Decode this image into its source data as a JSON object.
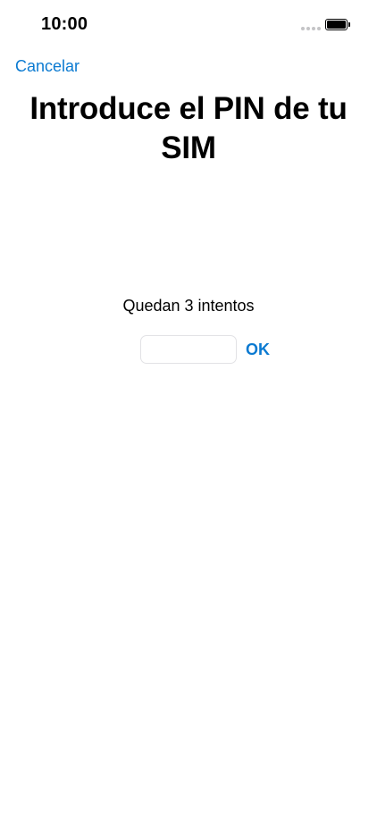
{
  "status_bar": {
    "time": "10:00",
    "signal_icon": "signal-dots-icon",
    "battery_icon": "battery-full-icon"
  },
  "nav": {
    "cancel_label": "Cancelar"
  },
  "main": {
    "title": "Introduce el PIN de tu SIM",
    "attempts_text": "Quedan 3 intentos",
    "pin_input_value": "",
    "ok_label": "OK"
  },
  "colors": {
    "accent": "#0b7ad1",
    "input_border": "#e2e2e5",
    "background": "#ffffff"
  }
}
